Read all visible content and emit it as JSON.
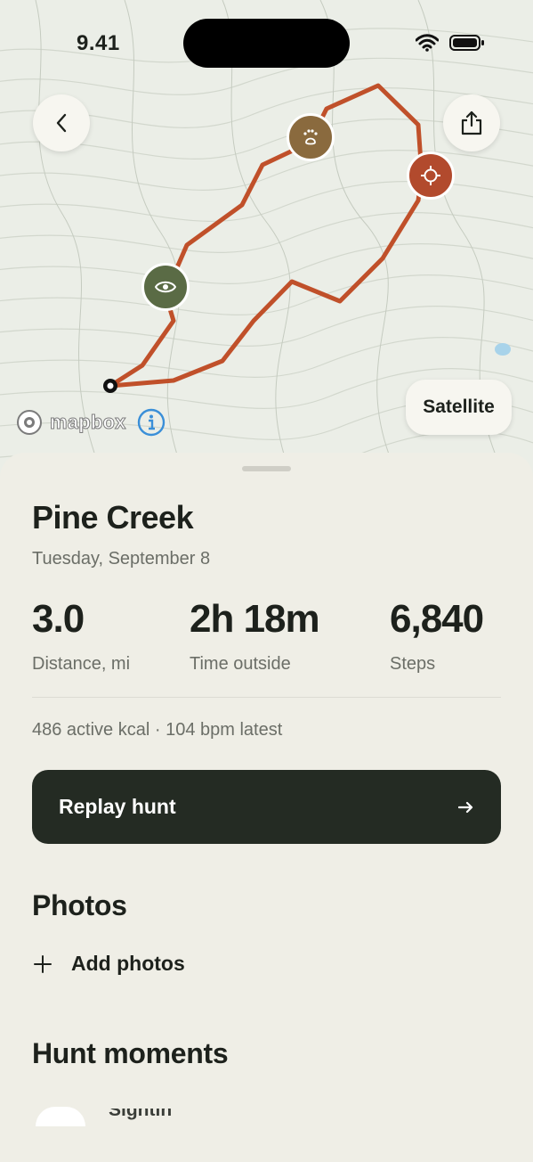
{
  "status_bar": {
    "time": "9.41"
  },
  "map": {
    "attribution": "mapbox",
    "satellite_label": "Satellite",
    "route_color": "#c0502a",
    "markers": [
      {
        "icon": "eye-icon",
        "color": "#5a6b45"
      },
      {
        "icon": "paw-print-icon",
        "color": "#8a6a3e"
      },
      {
        "icon": "crosshair-icon",
        "color": "#b24a2d"
      }
    ]
  },
  "hunt": {
    "title": "Pine Creek",
    "date": "Tuesday, September 8",
    "stats": [
      {
        "value": "3.0",
        "label": "Distance, mi"
      },
      {
        "value": "2h 18m",
        "label": "Time outside"
      },
      {
        "value": "6,840",
        "label": "Steps"
      }
    ],
    "extra": "486 active kcal · 104 bpm latest",
    "replay_label": "Replay hunt"
  },
  "photos": {
    "heading": "Photos",
    "add_label": "Add photos"
  },
  "moments": {
    "heading": "Hunt moments",
    "first_item": "Sighting"
  }
}
